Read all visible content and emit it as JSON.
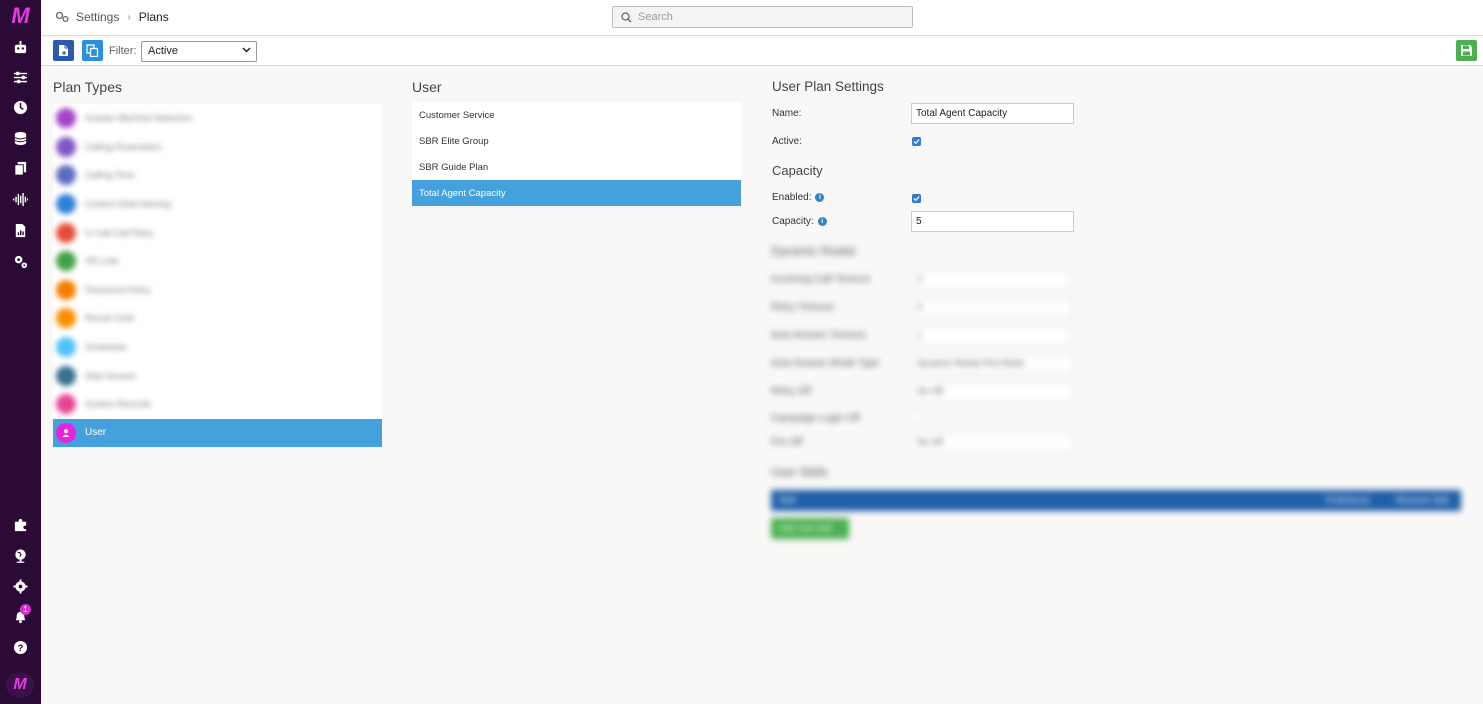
{
  "sidebar": {
    "logo": "M",
    "items": [
      {
        "icon": "robot-icon"
      },
      {
        "icon": "sliders-icon"
      },
      {
        "icon": "clock-dashboard-icon"
      },
      {
        "icon": "database-icon"
      },
      {
        "icon": "documents-icon"
      },
      {
        "icon": "waveform-icon"
      },
      {
        "icon": "report-icon"
      },
      {
        "icon": "gears-icon"
      },
      {
        "icon": "puzzle-icon"
      },
      {
        "icon": "globe-icon"
      },
      {
        "icon": "gear-icon"
      },
      {
        "icon": "bell-icon"
      },
      {
        "icon": "help-icon"
      }
    ],
    "notification_count": "1"
  },
  "header": {
    "breadcrumb": [
      "Settings",
      "Plans"
    ],
    "search_placeholder": "Search"
  },
  "toolbar": {
    "filter_label": "Filter:",
    "filter_value": "Active",
    "accent": "#4caf50"
  },
  "plan_types": {
    "title": "Plan Types",
    "items": [
      {
        "label": "Answer Machine Detection",
        "color": "#a443c7",
        "blurred": true
      },
      {
        "label": "Calling Parameters",
        "color": "#7e57c2",
        "blurred": true
      },
      {
        "label": "Calling Time",
        "color": "#5c6bc0",
        "blurred": true
      },
      {
        "label": "Custom Data Naming",
        "color": "#2f7fd6",
        "blurred": true
      },
      {
        "label": "In Call Call Plans",
        "color": "#e74c3c",
        "blurred": true
      },
      {
        "label": "HR Lists",
        "color": "#43a047",
        "blurred": true
      },
      {
        "label": "Password Policy",
        "color": "#f57c00",
        "blurred": true
      },
      {
        "label": "Result Code",
        "color": "#fb8c00",
        "blurred": true
      },
      {
        "label": "Schedules",
        "color": "#4fc3f7",
        "blurred": true
      },
      {
        "label": "Skip Senario",
        "color": "#37718e",
        "blurred": true
      },
      {
        "label": "System Records",
        "color": "#e84393",
        "blurred": true
      },
      {
        "label": "User",
        "color": "#e922dc",
        "blurred": false,
        "active": true
      }
    ]
  },
  "user_plans": {
    "title": "User",
    "items": [
      {
        "label": "Customer Service"
      },
      {
        "label": "SBR Elite Group"
      },
      {
        "label": "SBR Guide Plan"
      },
      {
        "label": "Total Agent Capacity",
        "active": true
      }
    ]
  },
  "settings": {
    "title": "User Plan Settings",
    "name_label": "Name:",
    "name_value": "Total Agent Capacity",
    "active_label": "Active:",
    "active_checked": true,
    "capacity_title": "Capacity",
    "enabled_label": "Enabled:",
    "enabled_checked": true,
    "capacity_label": "Capacity:",
    "capacity_value": "5"
  },
  "blurred_section": {
    "title": "Dynamic Redial",
    "rows": [
      {
        "label": "Incoming Call Timeout",
        "value": "0"
      },
      {
        "label": "Retry Timeout",
        "value": "0"
      },
      {
        "label": "Auto Answer Timeout",
        "value": "1"
      },
      {
        "label": "Auto Answer Mode Type",
        "value": "Dynamic Redial Pick Mode"
      },
      {
        "label": "Retry Off",
        "value": "No Off"
      },
      {
        "label": "Campaign Login Off",
        "value": ""
      },
      {
        "label": "Pre Off",
        "value": "No Off"
      }
    ],
    "skills_title": "User Skills",
    "bar_left": "Skill",
    "bar_mid": "Proficiency",
    "bar_right": "Remove Skill",
    "add_button": "Add new skill"
  }
}
